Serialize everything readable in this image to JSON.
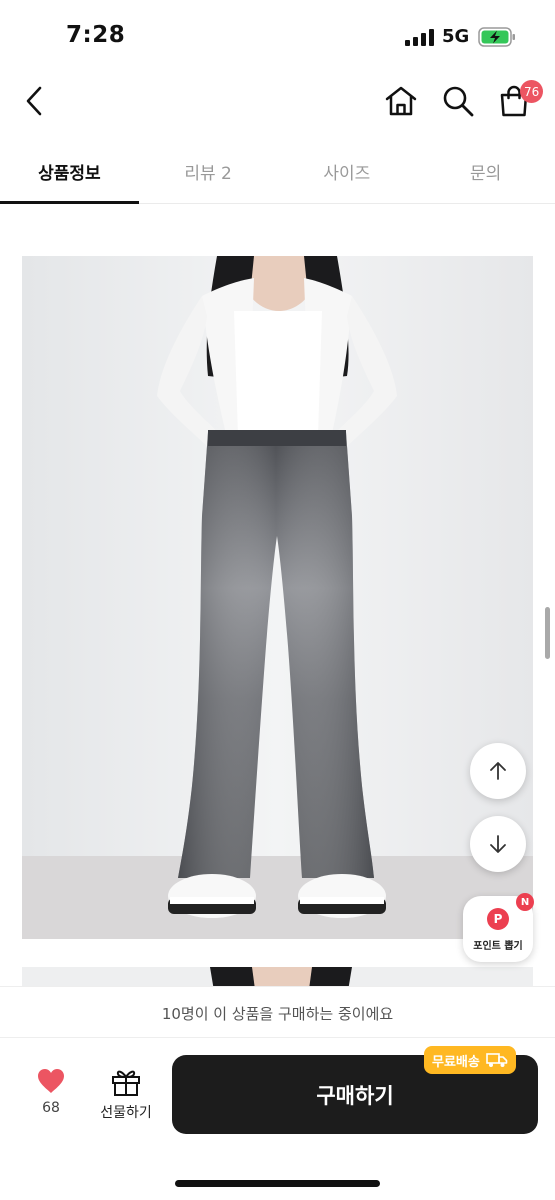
{
  "status_bar": {
    "time": "7:28",
    "network": "5G"
  },
  "header": {
    "back_icon": "chevron-left-icon",
    "home_icon": "home-icon",
    "search_icon": "search-icon",
    "cart_icon": "shopping-bag-icon",
    "cart_count": "76"
  },
  "tabs": [
    {
      "label": "상품정보",
      "active": true
    },
    {
      "label": "리뷰 2",
      "active": false
    },
    {
      "label": "사이즈",
      "active": false
    },
    {
      "label": "문의",
      "active": false
    }
  ],
  "floating": {
    "scroll_up_icon": "arrow-up-icon",
    "scroll_down_icon": "arrow-down-icon",
    "point_letter": "P",
    "point_badge": "N",
    "point_label": "포인트 뽑기"
  },
  "notice": "10명이 이 상품을 구매하는 중이에요",
  "bottom": {
    "like_count": "68",
    "gift_label": "선물하기",
    "buy_label": "구매하기",
    "free_shipping": "무료배송"
  },
  "colors": {
    "accent": "#ec5562",
    "buy_button": "#1c1c1c",
    "shipping_badge": "#ffb822"
  }
}
